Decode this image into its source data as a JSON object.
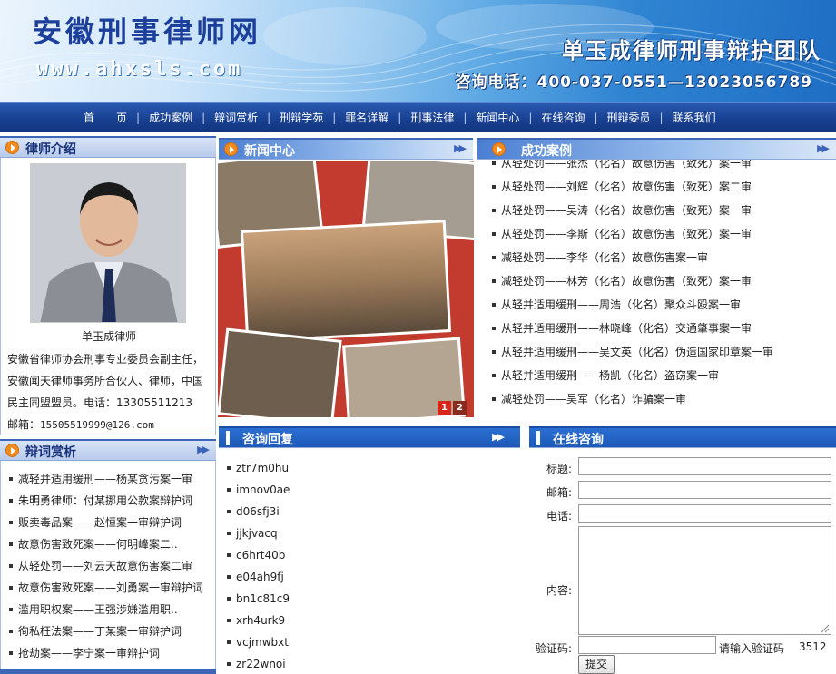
{
  "banner": {
    "title": "安徽刑事律师网",
    "url": "www.ahxsls.com",
    "team": "单玉成律师刑事辩护团队",
    "phone": "咨询电话：400-037-0551—13023056789"
  },
  "nav": {
    "items": [
      "首　　页",
      "成功案例",
      "辩词赏析",
      "刑辩学苑",
      "罪名详解",
      "刑事法律",
      "新闻中心",
      "在线咨询",
      "刑辩委员",
      "联系我们"
    ],
    "separator": "|"
  },
  "lawyer": {
    "header": "律师介绍",
    "name": "单玉成律师",
    "desc": "安徽省律师协会刑事专业委员会副主任，安徽闻天律师事务所合伙人、律师，中国民主同盟盟员。电话：13305511213　邮箱：",
    "email": "15505519999@126.com"
  },
  "news": {
    "header": "新闻中心",
    "pages": [
      "1",
      "2"
    ]
  },
  "cases": {
    "header": "成功案例",
    "items": [
      "从轻处罚——张杰（化名）故意伤害（致死）案一审",
      "从轻处罚——刘辉（化名）故意伤害（致死）案二审",
      "从轻处罚——吴涛（化名）故意伤害（致死）案一审",
      "从轻处罚——李斯（化名）故意伤害（致死）案一审",
      "减轻处罚——李华（化名）故意伤害案一审",
      "减轻处罚——林芳（化名）故意伤害（致死）案一审",
      "从轻并适用缓刑——周浩（化名）聚众斗殴案一审",
      "从轻并适用缓刑——林晓峰（化名）交通肇事案一审",
      "从轻并适用缓刑——吴文英（化名）伪造国家印章案一审",
      "从轻并适用缓刑——杨凯（化名）盗窃案一审",
      "减轻处罚——吴军（化名）诈骗案一审"
    ]
  },
  "speeches": {
    "header": "辩词赏析",
    "items": [
      "减轻并适用缓刑——杨某贪污案一审",
      "朱明勇律师：付某挪用公款案辩护词",
      "贩卖毒品案——赵恒案一审辩护词",
      "故意伤害致死案——何明峰案二..",
      "从轻处罚——刘云天故意伤害案二审",
      "故意伤害致死案——刘勇案一审辩护词",
      "滥用职权案——王强涉嫌滥用职..",
      "徇私枉法案——丁某案一审辩护词",
      "抢劫案——李宁案一审辩护词"
    ]
  },
  "consult": {
    "header": "咨询回复",
    "items": [
      "ztr7m0hu",
      "imnov0ae",
      "d06sfj3i",
      "jjkjvacq",
      "c6hrt40b",
      "e04ah9fj",
      "bn1c81c9",
      "xrh4urk9",
      "vcjmwbxt",
      "zr22wnoi"
    ]
  },
  "online": {
    "header": "在线咨询",
    "title_label": "标题:",
    "email_label": "邮箱:",
    "phone_label": "电话:",
    "content_label": "内容:",
    "captcha_label": "验证码:",
    "captcha_hint": "请输入验证码",
    "captcha_code": "3512",
    "submit": "提交"
  },
  "colors": {
    "nav": "#173f8f",
    "accent": "#f28a1d",
    "header_blue": "#1e59b8"
  }
}
